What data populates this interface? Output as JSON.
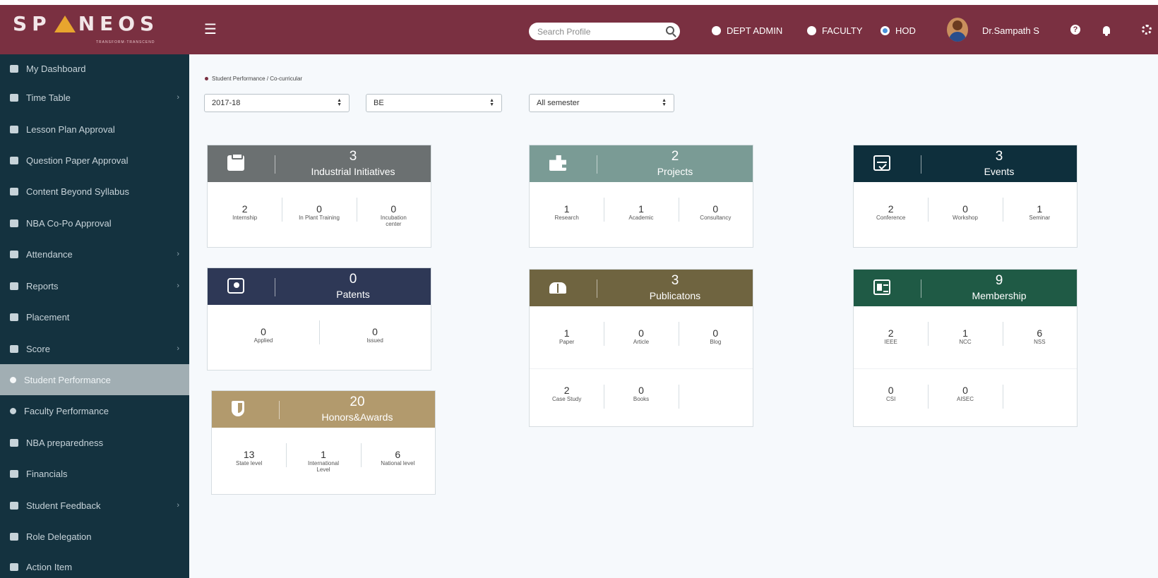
{
  "header": {
    "logo_text_a": "SP",
    "logo_text_b": "NEOS",
    "logo_tagline": "TRANSFORM·TRANSCEND",
    "search_placeholder": "Search Profile",
    "roles": [
      {
        "label": "DEPT ADMIN",
        "selected": false
      },
      {
        "label": "FACULTY",
        "selected": false
      },
      {
        "label": "HOD",
        "selected": true
      }
    ],
    "username": "Dr.Sampath S",
    "help_label": "?"
  },
  "sidebar": {
    "items": [
      {
        "label": "My Dashboard",
        "chevron": false,
        "active": false,
        "icon": "dashboard-icon"
      },
      {
        "label": "Time Table",
        "chevron": true,
        "active": false,
        "icon": "calendar-icon"
      },
      {
        "label": "Lesson Plan Approval",
        "chevron": false,
        "active": false,
        "icon": "table-icon"
      },
      {
        "label": "Question Paper Approval",
        "chevron": false,
        "active": false,
        "icon": "file-icon"
      },
      {
        "label": "Content Beyond Syllabus",
        "chevron": false,
        "active": false,
        "icon": "trash-icon"
      },
      {
        "label": "NBA Co-Po Approval",
        "chevron": false,
        "active": false,
        "icon": "institution-icon"
      },
      {
        "label": "Attendance",
        "chevron": true,
        "active": false,
        "icon": "bar-chart-icon"
      },
      {
        "label": "Reports",
        "chevron": true,
        "active": false,
        "icon": "report-icon"
      },
      {
        "label": "Placement",
        "chevron": false,
        "active": false,
        "icon": "monitor-icon"
      },
      {
        "label": "Score",
        "chevron": true,
        "active": false,
        "icon": "sitemap-icon"
      },
      {
        "label": "Student Performance",
        "chevron": false,
        "active": true,
        "icon": "dot-icon"
      },
      {
        "label": "Faculty Performance",
        "chevron": false,
        "active": false,
        "icon": "dot-icon"
      },
      {
        "label": "NBA preparedness",
        "chevron": false,
        "active": false,
        "icon": "institution-icon"
      },
      {
        "label": "Financials",
        "chevron": false,
        "active": false,
        "icon": "money-icon"
      },
      {
        "label": "Student Feedback",
        "chevron": true,
        "active": false,
        "icon": "comments-icon"
      },
      {
        "label": "Role Delegation",
        "chevron": false,
        "active": false,
        "icon": "users-icon"
      },
      {
        "label": "Action Item",
        "chevron": false,
        "active": false,
        "icon": "arrows-icon"
      }
    ]
  },
  "breadcrumb": {
    "text": "Student Performance / Co-curricular"
  },
  "filters": {
    "year": "2017-18",
    "program": "BE",
    "semester": "All semester"
  },
  "cards": {
    "industrial": {
      "count": "3",
      "title": "Industrial Initiatives",
      "color": "#6b7071",
      "icon": "clipboard-icon",
      "rows": [
        [
          {
            "value": "2",
            "label": "Internship"
          },
          {
            "value": "0",
            "label": "In Plant Training"
          },
          {
            "value": "0",
            "label": "Incubation center"
          }
        ]
      ]
    },
    "projects": {
      "count": "2",
      "title": "Projects",
      "color": "#7a9b95",
      "icon": "puzzle-icon",
      "rows": [
        [
          {
            "value": "1",
            "label": "Research"
          },
          {
            "value": "1",
            "label": "Academic"
          },
          {
            "value": "0",
            "label": "Consultancy"
          }
        ]
      ]
    },
    "events": {
      "count": "3",
      "title": "Events",
      "color": "#0e2f3c",
      "icon": "calendar-check-icon",
      "rows": [
        [
          {
            "value": "2",
            "label": "Conference"
          },
          {
            "value": "0",
            "label": "Workshop"
          },
          {
            "value": "1",
            "label": "Seminar"
          }
        ]
      ]
    },
    "patents": {
      "count": "0",
      "title": "Patents",
      "color": "#2e3856",
      "icon": "lightbulb-icon",
      "rows": [
        [
          {
            "value": "0",
            "label": "Applied"
          },
          {
            "value": "0",
            "label": "Issued"
          }
        ]
      ]
    },
    "publications": {
      "count": "3",
      "title": "Publicatons",
      "color": "#6f6440",
      "icon": "book-icon",
      "rows": [
        [
          {
            "value": "1",
            "label": "Paper"
          },
          {
            "value": "0",
            "label": "Article"
          },
          {
            "value": "0",
            "label": "Blog"
          }
        ],
        [
          {
            "value": "2",
            "label": "Case Study"
          },
          {
            "value": "0",
            "label": "Books"
          },
          {
            "value": "",
            "label": ""
          }
        ]
      ]
    },
    "membership": {
      "count": "9",
      "title": "Membership",
      "color": "#1f5a45",
      "icon": "id-card-icon",
      "rows": [
        [
          {
            "value": "2",
            "label": "IEEE"
          },
          {
            "value": "1",
            "label": "NCC"
          },
          {
            "value": "6",
            "label": "NSS"
          }
        ],
        [
          {
            "value": "0",
            "label": "CSI"
          },
          {
            "value": "0",
            "label": "AISEC"
          },
          {
            "value": "",
            "label": ""
          }
        ]
      ]
    },
    "honors": {
      "count": "20",
      "title": "Honors&Awards",
      "color": "#b29a6d",
      "icon": "shield-icon",
      "rows": [
        [
          {
            "value": "13",
            "label": "State level"
          },
          {
            "value": "1",
            "label": "International Level"
          },
          {
            "value": "6",
            "label": "National level"
          }
        ]
      ]
    }
  }
}
